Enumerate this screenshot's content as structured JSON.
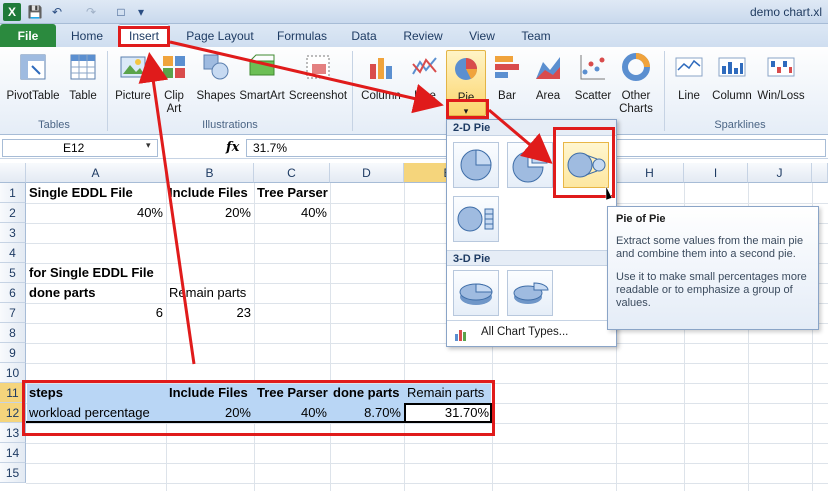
{
  "window": {
    "title": "demo chart.xl"
  },
  "ribbon_tabs": [
    {
      "label": "File"
    },
    {
      "label": "Home"
    },
    {
      "label": "Insert"
    },
    {
      "label": "Page Layout"
    },
    {
      "label": "Formulas"
    },
    {
      "label": "Data"
    },
    {
      "label": "Review"
    },
    {
      "label": "View"
    },
    {
      "label": "Team"
    }
  ],
  "groups": {
    "tables": "Tables",
    "illustrations": "Illustrations",
    "sparklines": "Sparklines"
  },
  "buttons": {
    "pivot": "PivotTable",
    "table": "Table",
    "picture": "Picture",
    "clipart1": "Clip",
    "clipart2": "Art",
    "shapes": "Shapes",
    "smartart": "SmartArt",
    "screenshot": "Screenshot",
    "column": "Column",
    "line": "Line",
    "pie": "Pie",
    "bar": "Bar",
    "area": "Area",
    "scatter": "Scatter",
    "other1": "Other",
    "other2": "Charts",
    "sp_line": "Line",
    "sp_column": "Column",
    "sp_winloss": "Win/Loss"
  },
  "formula_bar": {
    "name_box": "E12",
    "fx": "fx",
    "value": "31.7%"
  },
  "columns": [
    "A",
    "B",
    "C",
    "D",
    "E",
    "F",
    "G",
    "H",
    "I",
    "J"
  ],
  "rows": [
    "1",
    "2",
    "3",
    "4",
    "5",
    "6",
    "7",
    "8",
    "9",
    "10",
    "11",
    "12",
    "13",
    "14",
    "15"
  ],
  "cells": {
    "A1": "Single EDDL File",
    "B1": "Include Files",
    "C1": "Tree Parser",
    "A2": "40%",
    "B2": "20%",
    "C2": "40%",
    "A5": "for Single EDDL File",
    "A6": "done parts",
    "B6": "Remain parts",
    "A7": "6",
    "B7": "23",
    "A11": "steps",
    "B11": "Include Files",
    "C11": "Tree Parser",
    "D11": "done parts",
    "E11": "Remain parts",
    "A12": "workload percentage",
    "B12": "20%",
    "C12": "40%",
    "D12": "8.70%",
    "E12": "31.70%"
  },
  "pie_menu": {
    "section_2d": "2-D Pie",
    "section_3d": "3-D Pie",
    "all_chart_types": "All Chart Types..."
  },
  "tooltip": {
    "title": "Pie of Pie",
    "p1": "Extract some values from the main pie and combine them into a second pie.",
    "p2": "Use it to make small percentages more readable or to emphasize a group of values."
  },
  "colors": {
    "file_tab": "#2b8a3e",
    "annotation": "#e01b1b",
    "selection": "#b9d6f5"
  }
}
